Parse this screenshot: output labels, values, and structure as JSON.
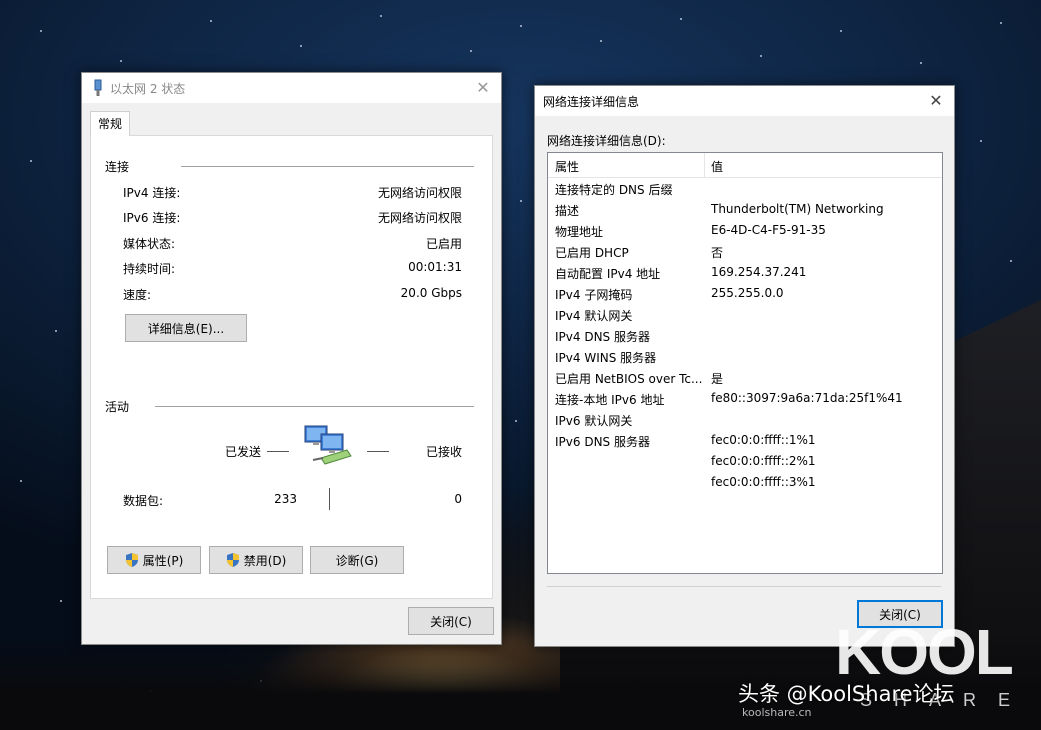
{
  "status_window": {
    "title": "以太网 2 状态",
    "tab": "常规",
    "connection_group": "连接",
    "rows": [
      {
        "label": "IPv4 连接:",
        "value": "无网络访问权限"
      },
      {
        "label": "IPv6 连接:",
        "value": "无网络访问权限"
      },
      {
        "label": "媒体状态:",
        "value": "已启用"
      },
      {
        "label": "持续时间:",
        "value": "00:01:31"
      },
      {
        "label": "速度:",
        "value": "20.0 Gbps"
      }
    ],
    "details_button": "详细信息(E)...",
    "activity_group": "活动",
    "sent_label": "已发送",
    "received_label": "已接收",
    "packets_label": "数据包:",
    "packets_sent": "233",
    "packets_received": "0",
    "properties_button": "属性(P)",
    "disable_button": "禁用(D)",
    "diagnose_button": "诊断(G)",
    "close_button": "关闭(C)"
  },
  "details_window": {
    "title": "网络连接详细信息",
    "caption": "网络连接详细信息(D):",
    "col_property": "属性",
    "col_value": "值",
    "rows": [
      {
        "property": "连接特定的 DNS 后缀",
        "value": ""
      },
      {
        "property": "描述",
        "value": "Thunderbolt(TM) Networking"
      },
      {
        "property": "物理地址",
        "value": "E6-4D-C4-F5-91-35"
      },
      {
        "property": "已启用 DHCP",
        "value": "否"
      },
      {
        "property": "自动配置 IPv4 地址",
        "value": "169.254.37.241"
      },
      {
        "property": "IPv4 子网掩码",
        "value": "255.255.0.0"
      },
      {
        "property": "IPv4 默认网关",
        "value": ""
      },
      {
        "property": "IPv4 DNS 服务器",
        "value": ""
      },
      {
        "property": "IPv4 WINS 服务器",
        "value": ""
      },
      {
        "property": "已启用 NetBIOS over Tc...",
        "value": "是"
      },
      {
        "property": "连接-本地 IPv6 地址",
        "value": "fe80::3097:9a6a:71da:25f1%41"
      },
      {
        "property": "IPv6 默认网关",
        "value": ""
      },
      {
        "property": "IPv6 DNS 服务器",
        "value": "fec0:0:0:ffff::1%1"
      },
      {
        "property": "",
        "value": "fec0:0:0:ffff::2%1"
      },
      {
        "property": "",
        "value": "fec0:0:0:ffff::3%1"
      }
    ],
    "close_button": "关闭(C)"
  },
  "watermark": {
    "brand": "KOOL",
    "brand_sub": "SHARE",
    "site": "koolshare.cn",
    "caption": "头条 @KoolShare论坛"
  },
  "colors": {
    "focus_border": "#0078d7",
    "button_bg": "#e1e1e1",
    "window_bg": "#f0f0f0"
  }
}
